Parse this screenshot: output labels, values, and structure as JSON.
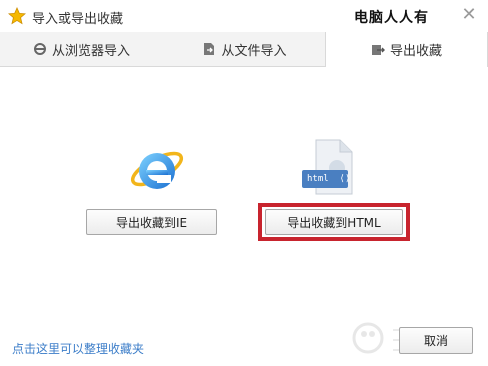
{
  "window": {
    "title": "导入或导出收藏",
    "watermark": "电脑人人有",
    "close_symbol": "✕"
  },
  "tabs": [
    {
      "label": "从浏览器导入",
      "icon": "ie-small-icon",
      "active": false
    },
    {
      "label": "从文件导入",
      "icon": "file-import-icon",
      "active": false
    },
    {
      "label": "导出收藏",
      "icon": "export-icon",
      "active": true
    }
  ],
  "main": {
    "html_badge": "html  ⟨⟩",
    "export_ie_label": "导出收藏到IE",
    "export_html_label": "导出收藏到HTML"
  },
  "footer": {
    "manage_link": "点击这里可以整理收藏夹",
    "cancel_label": "取消"
  },
  "colors": {
    "highlight": "#c8242e",
    "link": "#3d7ec9",
    "star": "#f5b800"
  }
}
